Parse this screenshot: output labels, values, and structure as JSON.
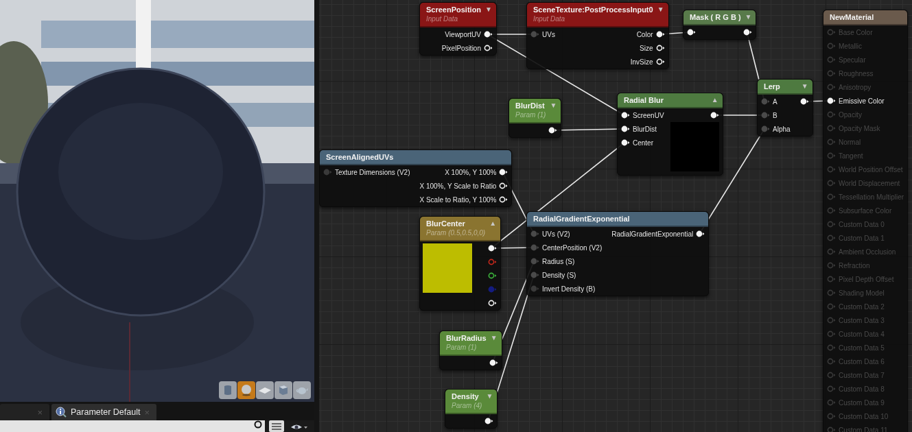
{
  "viewport": {
    "kind": "picture",
    "preview_shapes": [
      {
        "kind": "cylinder",
        "selected": false
      },
      {
        "kind": "sphere",
        "selected": true
      },
      {
        "kind": "plane",
        "selected": false
      },
      {
        "kind": "cube",
        "selected": false
      },
      {
        "kind": "teapot",
        "selected": false
      }
    ]
  },
  "tabs": [
    {
      "close": "×",
      "selected": false
    },
    {
      "label": "Parameter Default",
      "close": "×",
      "selected": true
    }
  ],
  "details_toolbar": {
    "search": true,
    "view_options": true
  },
  "graph": {
    "nodes": [
      {
        "title": "ScreenPosition",
        "subtitle": "Input Data",
        "color": "#8a1616",
        "arrow": "▼",
        "kind": "expression",
        "pins": [
          {
            "kind": "output",
            "label": "ViewportUV",
            "filled": true
          },
          {
            "kind": "output",
            "label": "PixelPosition",
            "filled": false
          }
        ]
      },
      {
        "title": "SceneTexture:PostProcessInput0",
        "subtitle": "Input Data",
        "color": "#8a1616",
        "arrow": "▼",
        "kind": "expression",
        "pins": [
          {
            "kind": "input",
            "label": "UVs",
            "filled": true,
            "color": "#4a4a4a"
          },
          {
            "kind": "output",
            "label": "Color",
            "filled": true
          },
          {
            "kind": "output",
            "label": "Size",
            "filled": false
          },
          {
            "kind": "output",
            "label": "InvSize",
            "filled": false
          }
        ]
      },
      {
        "title": "Mask ( R G B )",
        "color": "#587a4a",
        "arrow": "▼",
        "kind": "expression",
        "pins": [
          {
            "kind": "input",
            "filled": true
          },
          {
            "kind": "output",
            "filled": true
          }
        ]
      },
      {
        "title": "NewMaterial",
        "color": "#6a5a4c",
        "kind": "result",
        "pins": [
          {
            "kind": "input",
            "label": "Base Color",
            "filled": false,
            "disabled": true
          },
          {
            "kind": "input",
            "label": "Metallic",
            "filled": false,
            "disabled": true
          },
          {
            "kind": "input",
            "label": "Specular",
            "filled": false,
            "disabled": true
          },
          {
            "kind": "input",
            "label": "Roughness",
            "filled": false,
            "disabled": true
          },
          {
            "kind": "input",
            "label": "Anisotropy",
            "filled": false,
            "disabled": true
          },
          {
            "kind": "input",
            "label": "Emissive Color",
            "filled": true,
            "disabled": false
          },
          {
            "kind": "input",
            "label": "Opacity",
            "filled": false,
            "disabled": true
          },
          {
            "kind": "input",
            "label": "Opacity Mask",
            "filled": false,
            "disabled": true
          },
          {
            "kind": "input",
            "label": "Normal",
            "filled": false,
            "disabled": true
          },
          {
            "kind": "input",
            "label": "Tangent",
            "filled": false,
            "disabled": true
          },
          {
            "kind": "input",
            "label": "World Position Offset",
            "filled": false,
            "disabled": true
          },
          {
            "kind": "input",
            "label": "World Displacement",
            "filled": false,
            "disabled": true
          },
          {
            "kind": "input",
            "label": "Tessellation Multiplier",
            "filled": false,
            "disabled": true
          },
          {
            "kind": "input",
            "label": "Subsurface Color",
            "filled": false,
            "disabled": true
          },
          {
            "kind": "input",
            "label": "Custom Data 0",
            "filled": false,
            "disabled": true
          },
          {
            "kind": "input",
            "label": "Custom Data 1",
            "filled": false,
            "disabled": true
          },
          {
            "kind": "input",
            "label": "Ambient Occlusion",
            "filled": false,
            "disabled": true
          },
          {
            "kind": "input",
            "label": "Refraction",
            "filled": false,
            "disabled": true
          },
          {
            "kind": "input",
            "label": "Pixel Depth Offset",
            "filled": false,
            "disabled": true
          },
          {
            "kind": "input",
            "label": "Shading Model",
            "filled": false,
            "disabled": true
          },
          {
            "kind": "input",
            "label": "Custom Data 2",
            "filled": false,
            "disabled": true
          },
          {
            "kind": "input",
            "label": "Custom Data 3",
            "filled": false,
            "disabled": true
          },
          {
            "kind": "input",
            "label": "Custom Data 4",
            "filled": false,
            "disabled": true
          },
          {
            "kind": "input",
            "label": "Custom Data 5",
            "filled": false,
            "disabled": true
          },
          {
            "kind": "input",
            "label": "Custom Data 6",
            "filled": false,
            "disabled": true
          },
          {
            "kind": "input",
            "label": "Custom Data 7",
            "filled": false,
            "disabled": true
          },
          {
            "kind": "input",
            "label": "Custom Data 8",
            "filled": false,
            "disabled": true
          },
          {
            "kind": "input",
            "label": "Custom Data 9",
            "filled": false,
            "disabled": true
          },
          {
            "kind": "input",
            "label": "Custom Data 10",
            "filled": false,
            "disabled": true
          },
          {
            "kind": "input",
            "label": "Custom Data 11",
            "filled": false,
            "disabled": true
          }
        ]
      },
      {
        "title": "Lerp",
        "color": "#4e7a40",
        "arrow": "▼",
        "kind": "expression",
        "pins": [
          {
            "kind": "input",
            "label": "A",
            "filled": true,
            "color": "#4a4a4a"
          },
          {
            "kind": "input",
            "label": "B",
            "filled": true,
            "color": "#4a4a4a"
          },
          {
            "kind": "input",
            "label": "Alpha",
            "filled": true,
            "color": "#4a4a4a"
          },
          {
            "kind": "output",
            "filled": true
          }
        ]
      },
      {
        "title": "Radial Blur",
        "color": "#4e7a40",
        "arrow": "▲",
        "kind": "preview",
        "pins": [
          {
            "kind": "input",
            "label": "ScreenUV",
            "filled": true
          },
          {
            "kind": "input",
            "label": "BlurDist",
            "filled": true
          },
          {
            "kind": "input",
            "label": "Center",
            "filled": true
          },
          {
            "kind": "output",
            "filled": true
          }
        ]
      },
      {
        "title": "BlurDist",
        "subtitle": "Param (1)",
        "color": "#5a8a3a",
        "arrow": "▼",
        "kind": "expression",
        "pins": [
          {
            "kind": "output",
            "filled": true
          }
        ]
      },
      {
        "title": "ScreenAlignedUVs",
        "color": "#4a6478",
        "kind": "expression",
        "pins": [
          {
            "kind": "input",
            "label": "Texture Dimensions (V2)",
            "filled": true,
            "color": "#3a3a3a"
          },
          {
            "kind": "output",
            "label": "X 100%, Y 100%",
            "filled": true
          },
          {
            "kind": "output",
            "label": "X 100%, Y Scale to Ratio",
            "filled": false
          },
          {
            "kind": "output",
            "label": "X Scale to Ratio, Y 100%",
            "filled": false
          }
        ]
      },
      {
        "title": "BlurCenter",
        "subtitle": "Param (0.5,0.5,0,0)",
        "color": "#8a7430",
        "arrow": "▲",
        "kind": "swatch",
        "swatch": {
          "color": "#bdbd00"
        },
        "pins": [
          {
            "kind": "output",
            "filled": true
          },
          {
            "kind": "output",
            "filled": false,
            "color": "#c8281c"
          },
          {
            "kind": "output",
            "filled": false,
            "color": "#3cb43c"
          },
          {
            "kind": "output",
            "filled": true,
            "color": "#141c80"
          },
          {
            "kind": "output",
            "filled": false
          }
        ]
      },
      {
        "title": "RadialGradientExponential",
        "color": "#4a6478",
        "kind": "expression",
        "pins": [
          {
            "kind": "input",
            "label": "UVs (V2)",
            "filled": true,
            "color": "#4a4a4a"
          },
          {
            "kind": "input",
            "label": "CenterPosition (V2)",
            "filled": true,
            "color": "#4a4a4a"
          },
          {
            "kind": "input",
            "label": "Radius (S)",
            "filled": true,
            "color": "#4a4a4a"
          },
          {
            "kind": "input",
            "label": "Density (S)",
            "filled": true,
            "color": "#4a4a4a"
          },
          {
            "kind": "input",
            "label": "Invert Density (B)",
            "filled": true,
            "color": "#3a3a3a"
          },
          {
            "kind": "output",
            "label": "RadialGradientExponential",
            "filled": true
          }
        ]
      },
      {
        "title": "BlurRadius",
        "subtitle": "Param (1)",
        "color": "#5a8a3a",
        "arrow": "▼",
        "kind": "expression",
        "pins": [
          {
            "kind": "output",
            "filled": true
          }
        ]
      },
      {
        "title": "Density",
        "subtitle": "Param (4)",
        "color": "#5a8a3a",
        "arrow": "▼",
        "kind": "expression",
        "pins": [
          {
            "kind": "output",
            "filled": true
          }
        ]
      }
    ]
  }
}
